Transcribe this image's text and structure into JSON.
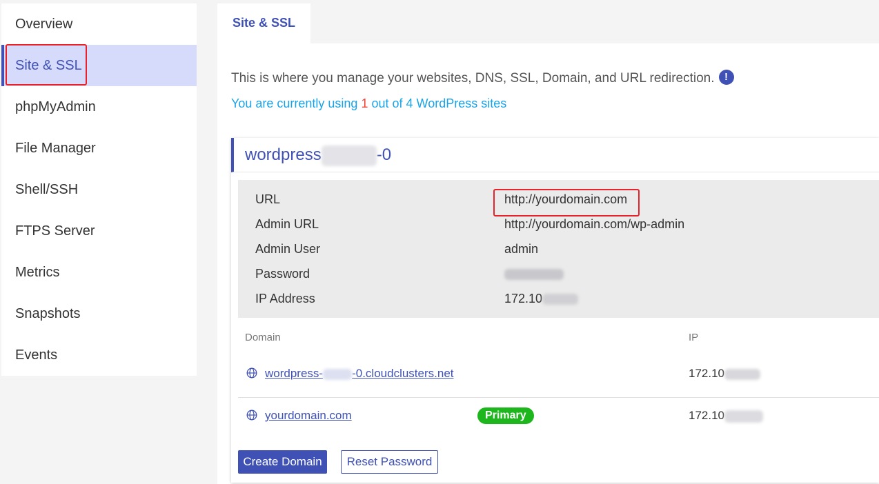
{
  "sidebar": {
    "items": [
      {
        "label": "Overview",
        "active": false
      },
      {
        "label": "Site & SSL",
        "active": true
      },
      {
        "label": "phpMyAdmin",
        "active": false
      },
      {
        "label": "File Manager",
        "active": false
      },
      {
        "label": "Shell/SSH",
        "active": false
      },
      {
        "label": "FTPS Server",
        "active": false
      },
      {
        "label": "Metrics",
        "active": false
      },
      {
        "label": "Snapshots",
        "active": false
      },
      {
        "label": "Events",
        "active": false
      }
    ]
  },
  "tabs": {
    "active_label": "Site & SSL"
  },
  "description": {
    "text": "This is where you manage your websites, DNS, SSL, Domain, and URL redirection.",
    "info_icon": "info-icon"
  },
  "usage": {
    "prefix": "You are currently using",
    "used": "1",
    "suffix": "out of 4 WordPress sites"
  },
  "site": {
    "name_prefix": "wordpress",
    "name_suffix": "-0",
    "details": [
      {
        "label": "URL",
        "value": "http://yourdomain.com"
      },
      {
        "label": "Admin URL",
        "value": "http://yourdomain.com/wp-admin"
      },
      {
        "label": "Admin User",
        "value": "admin"
      },
      {
        "label": "Password",
        "value": ""
      },
      {
        "label": "IP Address",
        "value": "172.10"
      }
    ]
  },
  "domains": {
    "headers": {
      "domain": "Domain",
      "ip": "IP"
    },
    "rows": [
      {
        "domain_prefix": "wordpress-",
        "domain_suffix": "-0.cloudclusters.net",
        "badge": "",
        "ip": "172.10"
      },
      {
        "domain_prefix": "yourdomain.com",
        "domain_suffix": "",
        "badge": "Primary",
        "ip": "172.10"
      }
    ]
  },
  "buttons": {
    "create_domain": "Create Domain",
    "reset_password": "Reset Password"
  },
  "colors": {
    "accent": "#3f51b5",
    "active_bg": "#d6dbfb",
    "highlight": "#e8222b",
    "usage_text": "#1aa3e8",
    "usage_num": "#f44336",
    "badge": "#1db71d"
  }
}
